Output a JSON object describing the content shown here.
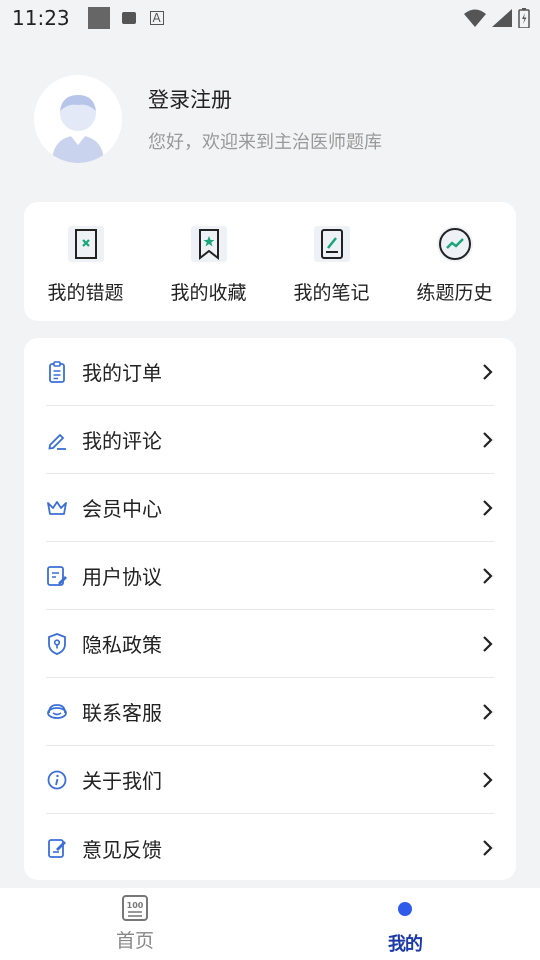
{
  "status_bar": {
    "time": "11:23",
    "a_glyph": "A"
  },
  "profile": {
    "login_title": "登录注册",
    "welcome": "您好，欢迎来到主治医师题库"
  },
  "quick_actions": [
    {
      "label": "我的错题",
      "icon": "wrong-questions-icon"
    },
    {
      "label": "我的收藏",
      "icon": "bookmark-icon"
    },
    {
      "label": "我的笔记",
      "icon": "notes-icon"
    },
    {
      "label": "练题历史",
      "icon": "history-chart-icon"
    }
  ],
  "menu": [
    {
      "label": "我的订单",
      "icon": "order-icon"
    },
    {
      "label": "我的评论",
      "icon": "comment-pen-icon"
    },
    {
      "label": "会员中心",
      "icon": "crown-icon"
    },
    {
      "label": "用户协议",
      "icon": "agreement-icon"
    },
    {
      "label": "隐私政策",
      "icon": "privacy-shield-icon"
    },
    {
      "label": "联系客服",
      "icon": "customer-service-icon"
    },
    {
      "label": "关于我们",
      "icon": "info-icon"
    },
    {
      "label": "意见反馈",
      "icon": "feedback-icon"
    }
  ],
  "tabs": {
    "home": {
      "label": "首页",
      "icon_text": "100"
    },
    "me": {
      "label": "我的"
    }
  },
  "colors": {
    "accent": "#2f5bea",
    "icon_green": "#1aa57a",
    "icon_blue": "#3a6fd8"
  }
}
